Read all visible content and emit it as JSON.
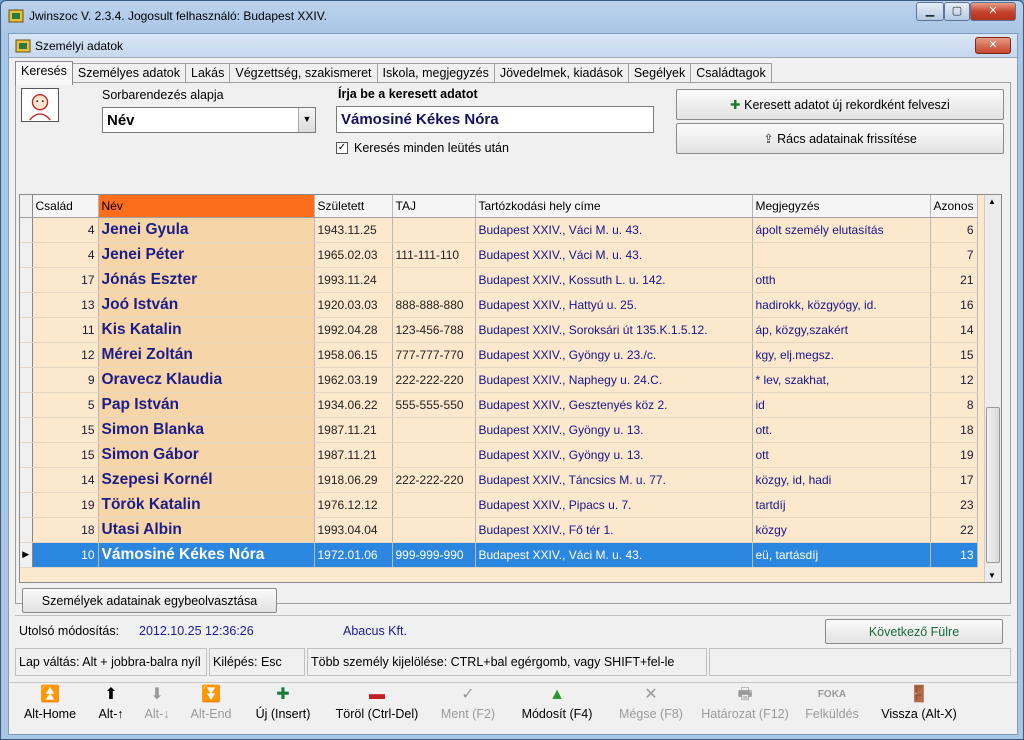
{
  "window": {
    "title": "Jwinszoc V. 2.3.4.  Jogosult felhasználó: Budapest XXIV."
  },
  "inner_window": {
    "title": "Személyi adatok"
  },
  "tabs": [
    {
      "label": "Keresés",
      "active": true
    },
    {
      "label": "Személyes adatok"
    },
    {
      "label": "Lakás"
    },
    {
      "label": "Végzettség, szakismeret"
    },
    {
      "label": "Iskola, megjegyzés"
    },
    {
      "label": "Jövedelmek, kiadások"
    },
    {
      "label": "Segélyek"
    },
    {
      "label": "Családtagok"
    }
  ],
  "search": {
    "sort_label": "Sorbarendezés alapja",
    "sort_value": "Név",
    "query_label": "Írja be a keresett adatot",
    "query_value": "Vámosiné Kékes Nóra",
    "checkbox_label": "Keresés minden leütés után",
    "checkbox_checked": true,
    "add_button": "Keresett adatot új rekordként felveszi",
    "refresh_button": "Rács adatainak frissítése"
  },
  "grid": {
    "columns": [
      "Család",
      "Név",
      "Született",
      "TAJ",
      "Tartózkodási hely címe",
      "Megjegyzés",
      "Azonos"
    ],
    "rows": [
      {
        "csalad": "4",
        "nev": "Jenei Gyula",
        "szuletett": "1943.11.25",
        "taj": "",
        "cim": "Budapest XXIV., Váci M. u. 43.",
        "megjegyzes": "ápolt személy elutasítás",
        "azonos": "6"
      },
      {
        "csalad": "4",
        "nev": "Jenei Péter",
        "szuletett": "1965.02.03",
        "taj": "111-111-110",
        "cim": "Budapest XXIV., Váci M. u. 43.",
        "megjegyzes": "",
        "azonos": "7"
      },
      {
        "csalad": "17",
        "nev": "Jónás Eszter",
        "szuletett": "1993.11.24",
        "taj": "",
        "cim": "Budapest XXIV., Kossuth L. u. 142.",
        "megjegyzes": "otth",
        "azonos": "21"
      },
      {
        "csalad": "13",
        "nev": "Joó István",
        "szuletett": "1920.03.03",
        "taj": "888-888-880",
        "cim": "Budapest XXIV., Hattyú u. 25.",
        "megjegyzes": "hadirokk, közgyógy, id.",
        "azonos": "16"
      },
      {
        "csalad": "11",
        "nev": "Kis Katalin",
        "szuletett": "1992.04.28",
        "taj": "123-456-788",
        "cim": "Budapest XXIV., Soroksári út 135.K.1.5.12.",
        "megjegyzes": "áp, közgy,szakért",
        "azonos": "14"
      },
      {
        "csalad": "12",
        "nev": "Mérei Zoltán",
        "szuletett": "1958.06.15",
        "taj": "777-777-770",
        "cim": "Budapest XXIV., Gyöngy u. 23./c.",
        "megjegyzes": "kgy, elj.megsz.",
        "azonos": "15"
      },
      {
        "csalad": "9",
        "nev": "Oravecz Klaudia",
        "szuletett": "1962.03.19",
        "taj": "222-222-220",
        "cim": "Budapest XXIV., Naphegy u. 24.C.",
        "megjegyzes": "* lev, szakhat,",
        "azonos": "12"
      },
      {
        "csalad": "5",
        "nev": "Pap István",
        "szuletett": "1934.06.22",
        "taj": "555-555-550",
        "cim": "Budapest XXIV., Gesztenyés köz 2.",
        "megjegyzes": "id",
        "azonos": "8"
      },
      {
        "csalad": "15",
        "nev": "Simon Blanka",
        "szuletett": "1987.11.21",
        "taj": "",
        "cim": "Budapest XXIV., Gyöngy u. 13.",
        "megjegyzes": "ott.",
        "azonos": "18"
      },
      {
        "csalad": "15",
        "nev": "Simon Gábor",
        "szuletett": "1987.11.21",
        "taj": "",
        "cim": "Budapest XXIV., Gyöngy u. 13.",
        "megjegyzes": "ott",
        "azonos": "19"
      },
      {
        "csalad": "14",
        "nev": "Szepesi Kornél",
        "szuletett": "1918.06.29",
        "taj": "222-222-220",
        "cim": "Budapest XXIV., Táncsics M. u. 77.",
        "megjegyzes": "közgy, id, hadi",
        "azonos": "17"
      },
      {
        "csalad": "19",
        "nev": "Török Katalin",
        "szuletett": "1976.12.12",
        "taj": "",
        "cim": "Budapest XXIV., Pipacs u. 7.",
        "megjegyzes": "tartdíj",
        "azonos": "23"
      },
      {
        "csalad": "18",
        "nev": "Utasi Albin",
        "szuletett": "1993.04.04",
        "taj": "",
        "cim": "Budapest XXIV., Fő tér 1.",
        "megjegyzes": "közgy",
        "azonos": "22"
      },
      {
        "csalad": "10",
        "nev": "Vámosiné Kékes Nóra",
        "szuletett": "1972.01.06",
        "taj": "999-999-990",
        "cim": "Budapest XXIV., Váci M. u. 43.",
        "megjegyzes": "eü, tartásdíj",
        "azonos": "13",
        "selected": true
      }
    ]
  },
  "merge_button": "Személyek adatainak egybeolvasztása",
  "status": {
    "last_mod_label": "Utolsó módosítás:",
    "last_mod_value": "2012.10.25 12:36:26",
    "company": "Abacus Kft.",
    "next_tab_button": "Következő Fülre",
    "hint_tab": "Lap váltás: Alt + jobbra-balra nyíl",
    "hint_exit": "Kilépés: Esc",
    "hint_multi": "Több személy kijelölése: CTRL+bal egérgomb, vagy SHIFT+fel-le"
  },
  "toolbar": [
    {
      "label": "Alt-Home",
      "icon": "first-icon",
      "glyph": "⏫",
      "enabled": true
    },
    {
      "label": "Alt-↑",
      "icon": "up-icon",
      "glyph": "⬆",
      "enabled": true
    },
    {
      "label": "Alt-↓",
      "icon": "down-icon",
      "glyph": "⬇",
      "enabled": false
    },
    {
      "label": "Alt-End",
      "icon": "last-icon",
      "glyph": "⏬",
      "enabled": false
    },
    {
      "label": "Új (Insert)",
      "icon": "plus-icon",
      "glyph": "✚",
      "enabled": true
    },
    {
      "label": "Töröl (Ctrl-Del)",
      "icon": "minus-icon",
      "glyph": "▬",
      "enabled": true
    },
    {
      "label": "Ment (F2)",
      "icon": "check-icon",
      "glyph": "✓",
      "enabled": false
    },
    {
      "label": "Módosít (F4)",
      "icon": "triangle-up-icon",
      "glyph": "▲",
      "enabled": true
    },
    {
      "label": "Mégse (F8)",
      "icon": "cross-icon",
      "glyph": "✕",
      "enabled": false
    },
    {
      "label": "Határozat (F12)",
      "icon": "printer-icon",
      "glyph": "🖶",
      "enabled": false
    },
    {
      "label": "Felküldés",
      "icon": "foka-icon",
      "glyph": "FOKA",
      "enabled": false
    },
    {
      "label": "Vissza (Alt-X)",
      "icon": "exit-icon",
      "glyph": "🚪",
      "enabled": true
    }
  ],
  "colors": {
    "accent_header": "#fc6d1c",
    "selected_row": "#2b86e0",
    "grid_bg": "#fce8cc",
    "name_col_bg": "#f6d6a8"
  }
}
